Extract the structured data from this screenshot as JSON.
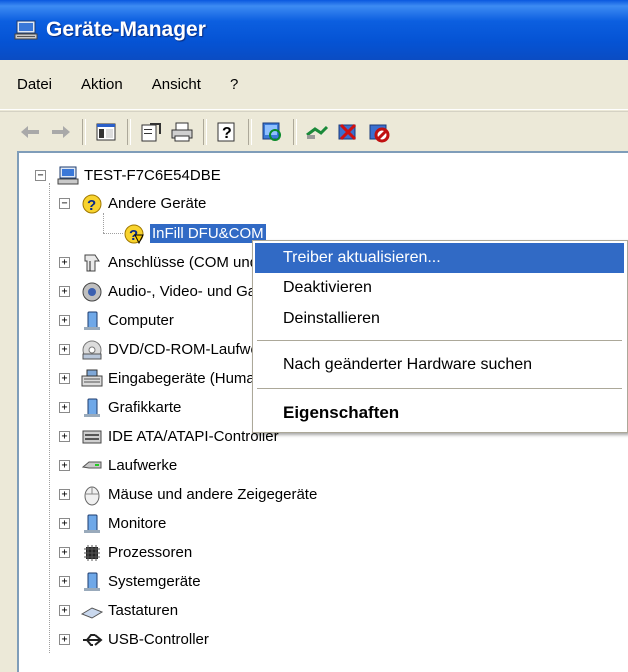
{
  "window": {
    "title": "Geräte-Manager"
  },
  "menu": [
    "Datei",
    "Aktion",
    "Ansicht",
    "?"
  ],
  "toolbar": {
    "buttons": [
      "back-arrow-icon",
      "forward-arrow-icon",
      "show-hide-tree-icon",
      "properties-icon",
      "print-icon",
      "help-icon",
      "scan-hardware-icon",
      "update-driver-icon",
      "uninstall-icon",
      "disable-icon"
    ]
  },
  "tree": {
    "root": "TEST-F7C6E54DBE",
    "other_devices": "Andere Geräte",
    "selected_device": "InFill DFU&COM",
    "categories": [
      "Anschlüsse (COM und LPT)",
      "Audio-, Video- und Gamecontroller",
      "Computer",
      "DVD/CD-ROM-Laufwerke",
      "Eingabegeräte (Human Interface Devices)",
      "Grafikkarte",
      "IDE ATA/ATAPI-Controller",
      "Laufwerke",
      "Mäuse und andere Zeigegeräte",
      "Monitore",
      "Prozessoren",
      "Systemgeräte",
      "Tastaturen",
      "USB-Controller"
    ]
  },
  "context_menu": {
    "update_driver": "Treiber aktualisieren...",
    "disable": "Deaktivieren",
    "uninstall": "Deinstallieren",
    "scan": "Nach geänderter Hardware suchen",
    "properties": "Eigenschaften"
  },
  "colors": {
    "titlebar": "#0553D4",
    "selection": "#316AC5",
    "face": "#ECE9D8"
  }
}
